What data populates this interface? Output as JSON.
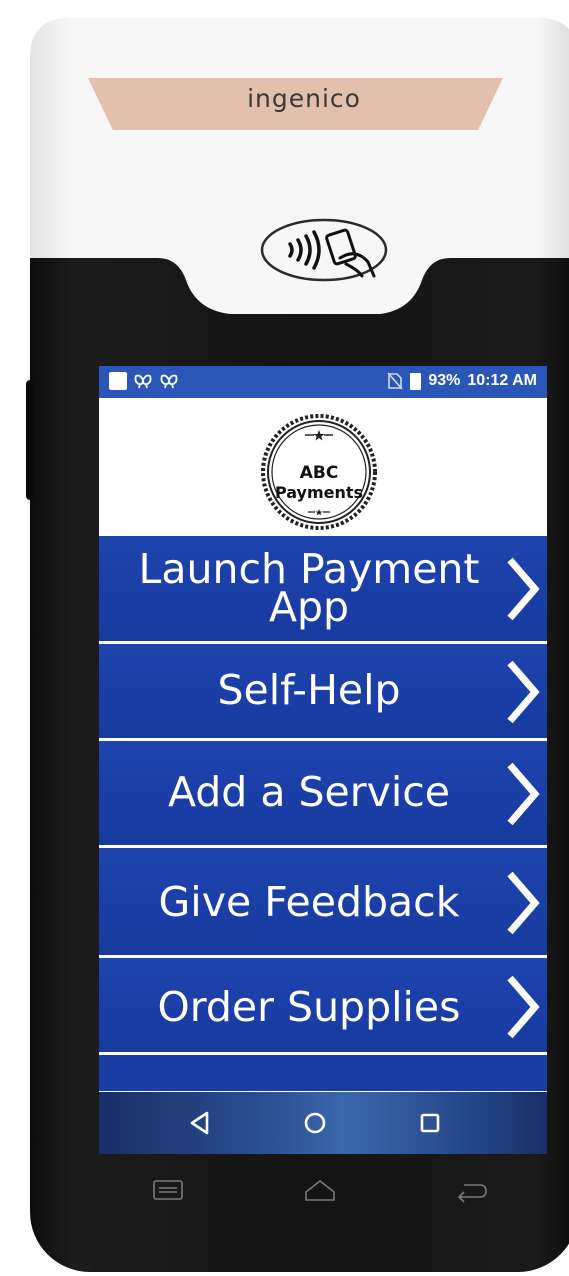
{
  "device": {
    "brand": "ingenico",
    "icons": [
      "contactless-icon",
      "hw-menu-icon",
      "hw-home-icon",
      "hw-back-icon"
    ]
  },
  "status_bar": {
    "battery": "93%",
    "time": "10:12 AM",
    "icons": [
      "notification-square-icon",
      "app-icon",
      "app-icon",
      "no-sim-icon",
      "battery-icon"
    ]
  },
  "logo": {
    "line1": "ABC",
    "line2": "Payments"
  },
  "menu": {
    "items": [
      {
        "label": "Launch Payment App",
        "line1": "Launch Payment",
        "line2": "App"
      },
      {
        "label": "Self-Help"
      },
      {
        "label": "Add a Service"
      },
      {
        "label": "Give Feedback"
      },
      {
        "label": "Order Supplies"
      }
    ]
  },
  "nav": {
    "icons": [
      "back-icon",
      "home-icon",
      "recents-icon"
    ]
  },
  "colors": {
    "primary_blue": "#1a3ea6",
    "status_blue": "#2a56b8",
    "device_white": "#f4f4f4",
    "device_black": "#141414",
    "brand_strip": "#e3bfae"
  }
}
